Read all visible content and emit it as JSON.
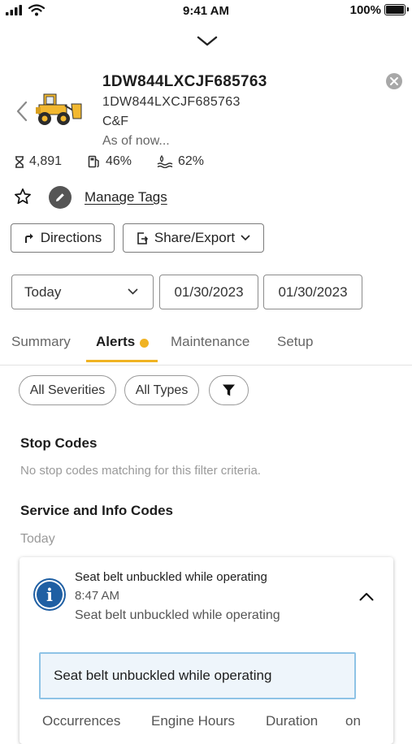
{
  "status_bar": {
    "time": "9:41 AM",
    "battery": "100%"
  },
  "asset": {
    "id": "1DW844LXCJF685763",
    "serial": "1DW844LXCJF685763",
    "owner": "C&F",
    "as_of": "As of now..."
  },
  "stats": {
    "hours": "4,891",
    "fuel": "46%",
    "def": "62%"
  },
  "manage_tags": "Manage Tags",
  "buttons": {
    "directions": "Directions",
    "share_export": "Share/Export"
  },
  "date_filter": {
    "range": "Today",
    "start": "01/30/2023",
    "end": "01/30/2023"
  },
  "tabs": [
    {
      "label": "Summary"
    },
    {
      "label": "Alerts",
      "active": true
    },
    {
      "label": "Maintenance"
    },
    {
      "label": "Setup"
    }
  ],
  "filters": {
    "severity": "All Severities",
    "types": "All Types"
  },
  "stop_codes": {
    "heading": "Stop Codes",
    "empty": "No stop codes matching for this filter criteria."
  },
  "service_codes": {
    "heading": "Service and Info Codes",
    "group": "Today"
  },
  "alert": {
    "title": "Seat belt unbuckled while operating",
    "time": "8:47 AM",
    "description": "Seat belt unbuckled while operating",
    "highlight": "Seat belt unbuckled while operating",
    "columns": [
      "Occurrences",
      "Engine Hours",
      "Duration",
      "on"
    ]
  },
  "colors": {
    "accent": "#f0b323",
    "info": "#1f5fa3",
    "highlight_border": "#8ec3e6"
  }
}
